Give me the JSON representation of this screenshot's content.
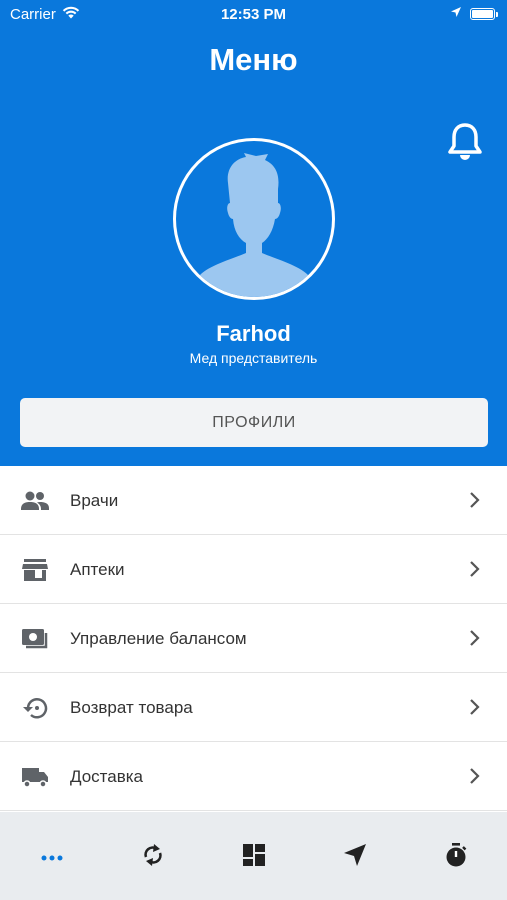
{
  "status_bar": {
    "carrier": "Carrier",
    "time": "12:53 PM"
  },
  "header": {
    "title": "Меню"
  },
  "profile": {
    "name": "Farhod",
    "role": "Мед представитель",
    "button_label": "ПРОФИЛИ"
  },
  "menu": {
    "items": [
      {
        "label": "Врачи",
        "icon": "people-icon"
      },
      {
        "label": "Аптеки",
        "icon": "store-icon"
      },
      {
        "label": "Управление балансом",
        "icon": "money-icon"
      },
      {
        "label": "Возврат товара",
        "icon": "restore-icon"
      },
      {
        "label": "Доставка",
        "icon": "truck-icon"
      }
    ]
  },
  "tabbar": {
    "tabs": [
      {
        "icon": "more-icon",
        "active": true
      },
      {
        "icon": "sync-icon",
        "active": false
      },
      {
        "icon": "dashboard-icon",
        "active": false
      },
      {
        "icon": "navigation-icon",
        "active": false
      },
      {
        "icon": "timer-icon",
        "active": false
      }
    ]
  },
  "colors": {
    "primary": "#0a78dc",
    "avatar_bg": "#9cc7f0",
    "text": "#333333",
    "icon_gray": "#5f6368",
    "tabbar_bg": "#e9ecef"
  }
}
